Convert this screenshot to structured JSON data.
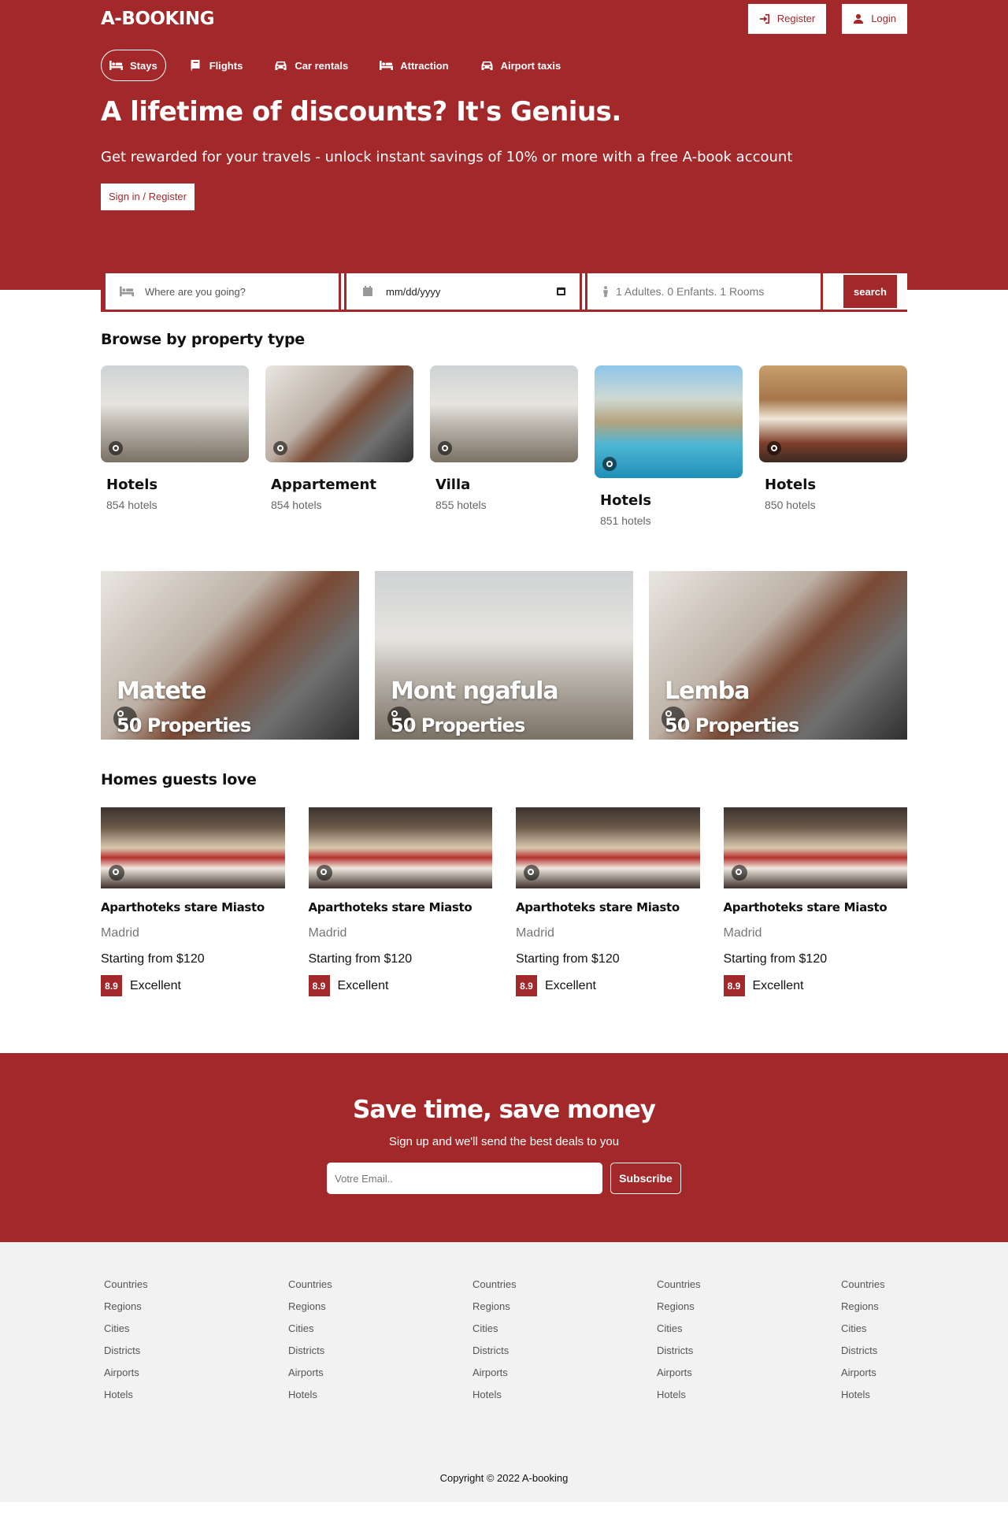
{
  "brand": {
    "logo": "A-BOOKING",
    "accent": "#a3282a"
  },
  "auth": {
    "register": "Register",
    "login": "Login"
  },
  "nav": [
    {
      "label": "Stays",
      "icon": "bed-icon"
    },
    {
      "label": "Flights",
      "icon": "book-icon"
    },
    {
      "label": "Car rentals",
      "icon": "car-icon"
    },
    {
      "label": "Attraction",
      "icon": "bed-icon"
    },
    {
      "label": "Airport taxis",
      "icon": "taxi-icon"
    }
  ],
  "hero": {
    "title": "A lifetime of discounts? It's Genius.",
    "subtitle": "Get rewarded for your travels - unlock instant savings of 10% or more with a free A-book account",
    "cta": "Sign in / Register"
  },
  "search": {
    "destination_placeholder": "Where are you going?",
    "date_value": "mm/dd/yyyy",
    "guests": "1 Adultes. 0 Enfants. 1 Rooms",
    "button": "search"
  },
  "property_types": {
    "heading": "Browse by property type",
    "items": [
      {
        "name": "Hotels",
        "count": "854 hotels"
      },
      {
        "name": "Appartement",
        "count": "854 hotels"
      },
      {
        "name": "Villa",
        "count": "855 hotels"
      },
      {
        "name": "Hotels",
        "count": "851 hotels"
      },
      {
        "name": "Hotels",
        "count": "850 hotels"
      }
    ]
  },
  "cities": [
    {
      "name": "Matete",
      "properties": "50 Properties"
    },
    {
      "name": "Mont ngafula",
      "properties": "50 Properties"
    },
    {
      "name": "Lemba",
      "properties": "50 Properties"
    }
  ],
  "homes": {
    "heading": "Homes guests love",
    "items": [
      {
        "name": "Aparthoteks stare Miasto",
        "city": "Madrid",
        "price": "Starting from $120",
        "score": "8.9",
        "rating": "Excellent"
      },
      {
        "name": "Aparthoteks stare Miasto",
        "city": "Madrid",
        "price": "Starting from $120",
        "score": "8.9",
        "rating": "Excellent"
      },
      {
        "name": "Aparthoteks stare Miasto",
        "city": "Madrid",
        "price": "Starting from $120",
        "score": "8.9",
        "rating": "Excellent"
      },
      {
        "name": "Aparthoteks stare Miasto",
        "city": "Madrid",
        "price": "Starting from $120",
        "score": "8.9",
        "rating": "Excellent"
      }
    ]
  },
  "newsletter": {
    "title": "Save time, save money",
    "subtitle": "Sign up and we'll send the best deals to you",
    "placeholder": "Votre Email..",
    "button": "Subscribe"
  },
  "footer": {
    "links": [
      "Countries",
      "Regions",
      "Cities",
      "Districts",
      "Airports",
      "Hotels"
    ],
    "copyright": "Copyright © 2022 A-booking"
  }
}
